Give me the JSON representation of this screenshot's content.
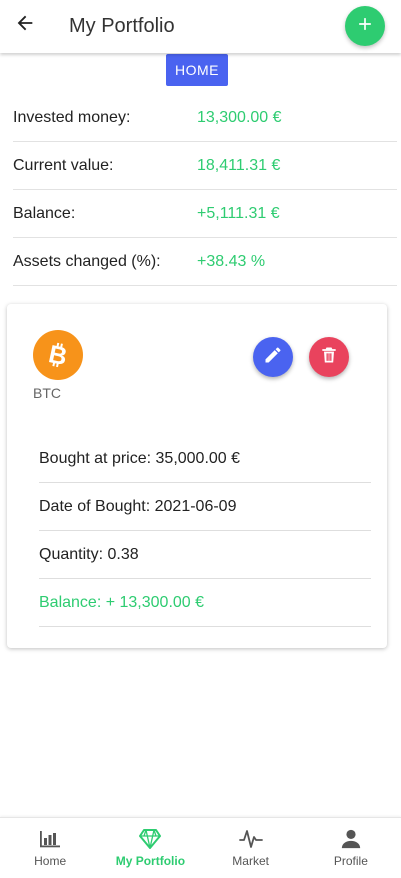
{
  "header": {
    "title": "My Portfolio",
    "back_icon": "arrow-left-icon",
    "add_icon": "plus-icon"
  },
  "home_chip": "HOME",
  "summary": [
    {
      "label": "Invested money:",
      "value": "13,300.00 €"
    },
    {
      "label": "Current value:",
      "value": "18,411.31 €"
    },
    {
      "label": "Balance:",
      "value": "+5,111.31 €"
    },
    {
      "label": "Assets changed (%):",
      "value": "+38.43 %"
    }
  ],
  "asset": {
    "symbol": "BTC",
    "coin_icon": "bitcoin-icon",
    "edit_icon": "pencil-icon",
    "delete_icon": "trash-icon",
    "details": [
      "Bought at price: 35,000.00 €",
      "Date of Bought: 2021-06-09",
      "Quantity: 0.38",
      "Balance: + 13,300.00 €"
    ]
  },
  "bottom_nav": [
    {
      "label": "Home",
      "icon": "bar-chart-icon"
    },
    {
      "label": "My Portfolio",
      "icon": "diamond-icon"
    },
    {
      "label": "Market",
      "icon": "pulse-icon"
    },
    {
      "label": "Profile",
      "icon": "person-icon"
    }
  ],
  "colors": {
    "accent_green": "#2ecc71",
    "primary_blue": "#4a63f0",
    "danger_red": "#e9435d",
    "bitcoin_orange": "#f7931a"
  }
}
